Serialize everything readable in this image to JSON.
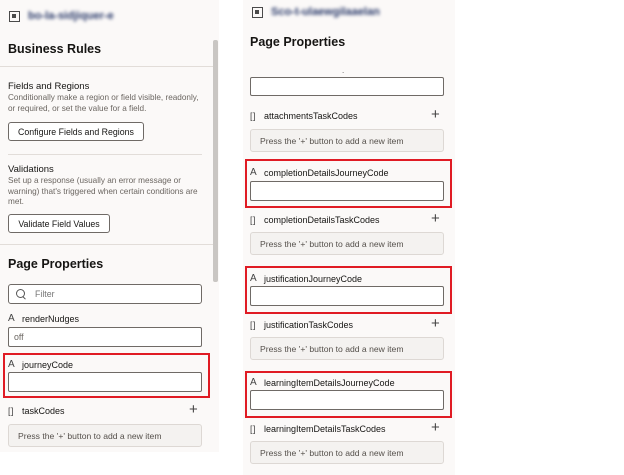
{
  "left": {
    "header_title": "bo-la-sidjiquer-e",
    "business_rules": {
      "title": "Business Rules",
      "fields_regions_title": "Fields and Regions",
      "fields_regions_desc": "Conditionally make a region or field visible, readonly, or required, or set the value for a field.",
      "configure_button": "Configure Fields and Regions",
      "validations_title": "Validations",
      "validations_desc": "Set up a response (usually an error message or warning) that's triggered when certain conditions are met.",
      "validate_button": "Validate Field Values"
    },
    "page_properties": {
      "title": "Page Properties",
      "filter_placeholder": "Filter",
      "render_nudges_label": "renderNudges",
      "render_nudges_value": "off",
      "journey_code_label": "journeyCode",
      "journey_code_value": "",
      "task_codes_label": "taskCodes",
      "task_codes_empty": "Press the '+' button to add a new item"
    }
  },
  "right": {
    "header_title": "Sco-t-ulaewgilaaelan",
    "page_properties_title": "Page Properties",
    "dot": ".",
    "top_field_value": "",
    "attachments_task_codes_label": "attachmentsTaskCodes",
    "attachments_task_codes_empty": "Press the '+' button to add a new item",
    "completion_journey_label": "completionDetailsJourneyCode",
    "completion_journey_value": "",
    "completion_task_codes_label": "completionDetailsTaskCodes",
    "completion_task_codes_empty": "Press the '+' button to add a new item",
    "justification_journey_label": "justificationJourneyCode",
    "justification_journey_value": "",
    "justification_task_codes_label": "justificationTaskCodes",
    "justification_task_codes_empty": "Press the '+' button to add a new item",
    "learning_journey_label": "learningItemDetailsJourneyCode",
    "learning_journey_value": "",
    "learning_task_codes_label": "learningItemDetailsTaskCodes",
    "learning_task_codes_empty": "Press the '+' button to add a new item"
  },
  "icons": {
    "text_type": "A",
    "array_type": "[ ]",
    "add": "+"
  },
  "colors": {
    "highlight": "#e01b24",
    "panel_bg": "#fbf9f8"
  }
}
